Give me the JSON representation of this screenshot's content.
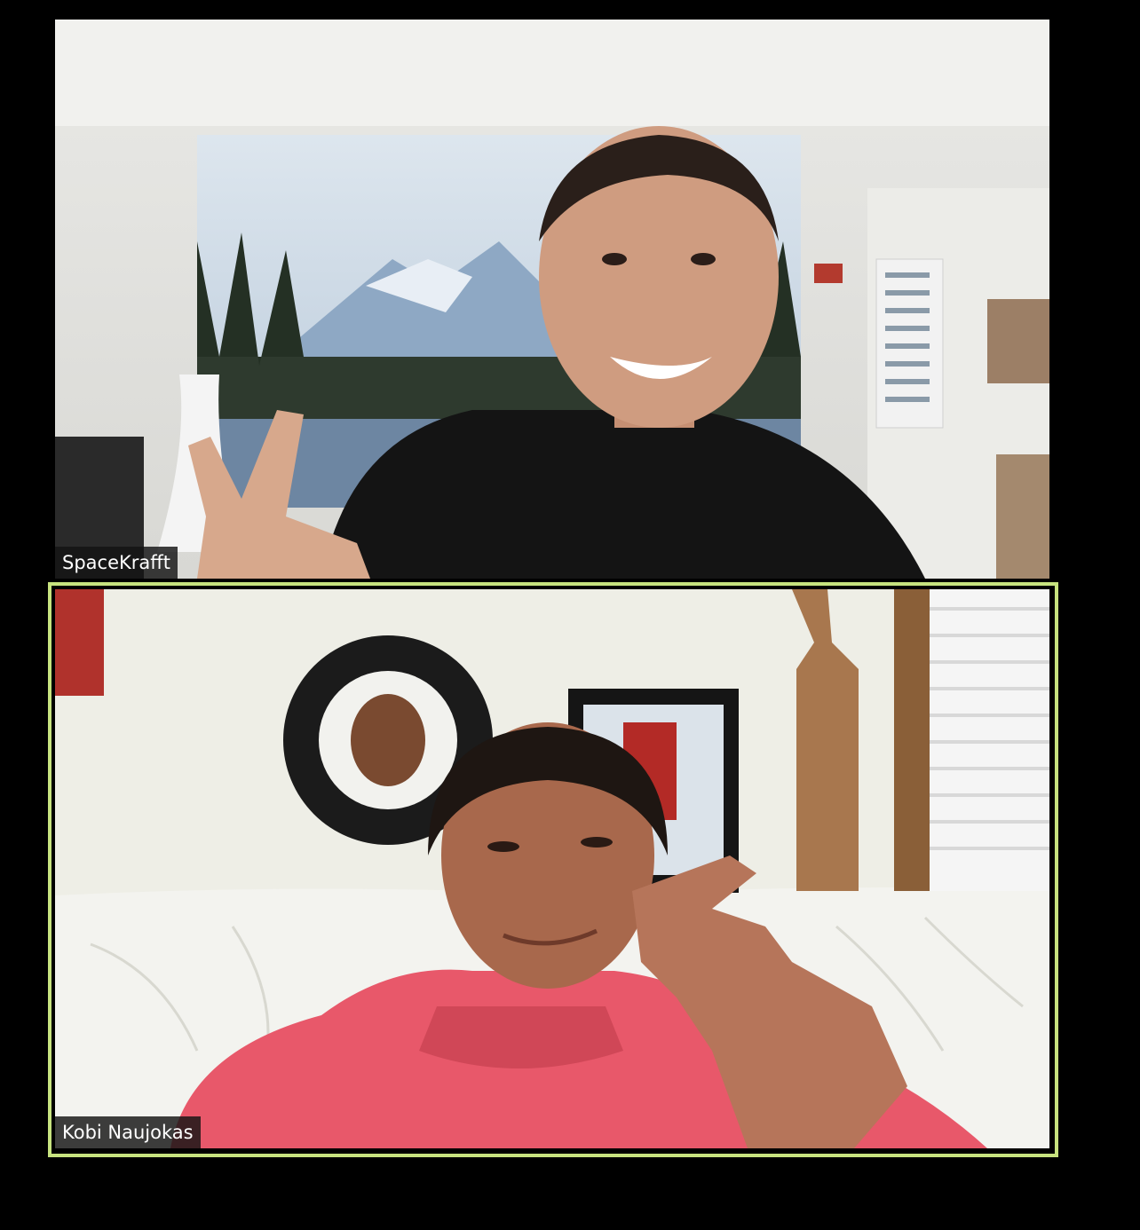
{
  "participants": [
    {
      "name": "SpaceKrafft",
      "active_speaker": false
    },
    {
      "name": "Kobi Naujokas",
      "active_speaker": true
    }
  ],
  "colors": {
    "background": "#000000",
    "active_speaker_border": "#c7e37f",
    "name_tag_bg": "#141414",
    "name_tag_text": "#ffffff"
  }
}
